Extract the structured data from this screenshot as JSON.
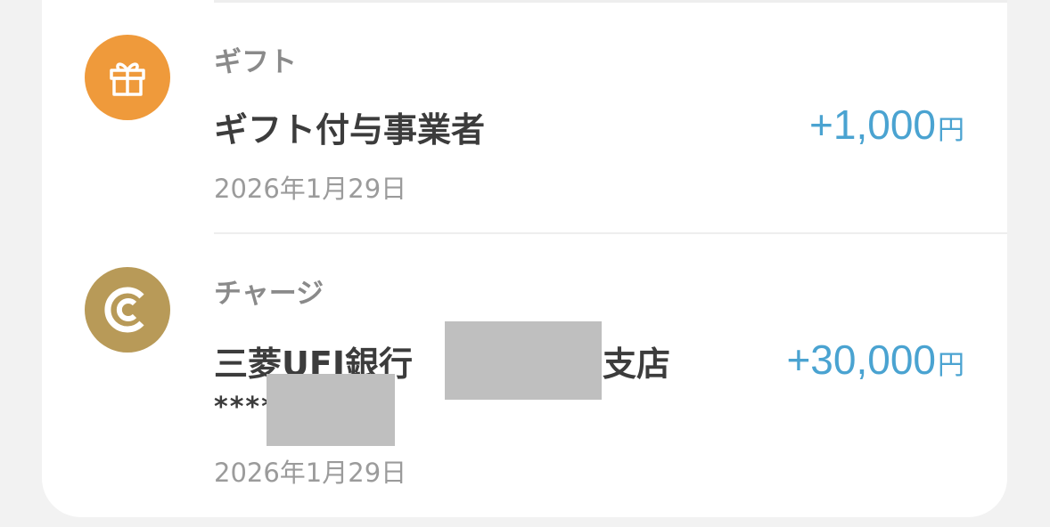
{
  "transactions": [
    {
      "category": "ギフト",
      "title": "ギフト付与事業者",
      "amount": "+1,000",
      "currency": "円",
      "date": "2026年1月29日",
      "icon": "gift-icon",
      "icon_color": "#ef9a3b"
    },
    {
      "category": "チャージ",
      "title_prefix": "三菱UFJ銀行",
      "title_suffix": "支店",
      "account_masked": "****",
      "amount": "+30,000",
      "currency": "円",
      "date": "2026年1月29日",
      "icon": "charge-c-icon",
      "icon_color": "#b89a58"
    }
  ],
  "colors": {
    "amount": "#4aa3d1",
    "title": "#3c3c3c",
    "muted": "#8a8a8a",
    "redaction": "#bfbfbf"
  }
}
